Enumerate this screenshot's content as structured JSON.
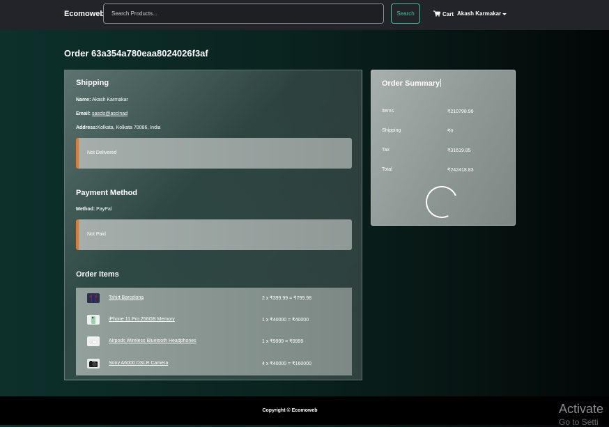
{
  "navbar": {
    "brand": "Ecomoweb",
    "search_placeholder": "Search Products...",
    "search_button": "Search",
    "cart_label": "Cart",
    "user_name": "Akash Karmakar"
  },
  "order": {
    "title": "Order 63a354a780eaa8024026f3af"
  },
  "shipping": {
    "title": "Shipping",
    "name_label": "Name:",
    "name_value": "Akash Karmakar",
    "email_label": "Email:",
    "email_value": "sascls@ascInad",
    "address_label": "Address:",
    "address_value": "Kolkata, Kolkata 70086, India",
    "status": "Not Delivered"
  },
  "payment": {
    "title": "Payment Method",
    "method_label": "Method:",
    "method_value": "PayPal",
    "status": "Not Paid"
  },
  "order_items": {
    "title": "Order Items",
    "items": [
      {
        "name": "Tshirt Barcelona",
        "calc": "2 x ₹399.99 = ₹799.98",
        "icon": "tshirt-icon"
      },
      {
        "name": "iPhone 11 Pro 256GB Memory",
        "calc": "1 x ₹40000 = ₹40000",
        "icon": "phone-icon"
      },
      {
        "name": "Airpods Wireless Bluetooth Headphones",
        "calc": "1 x ₹9999 = ₹9999",
        "icon": "airpods-icon"
      },
      {
        "name": "Sony A6000 DSLR Camera",
        "calc": "4 x ₹40000 = ₹160000",
        "icon": "camera-icon"
      }
    ]
  },
  "summary": {
    "title": "Order Summary",
    "rows": [
      {
        "label": "Items",
        "value": "₹210798.98"
      },
      {
        "label": "Shipping",
        "value": "₹0"
      },
      {
        "label": "Tax",
        "value": "₹31619.85"
      },
      {
        "label": "Total",
        "value": "₹242418.83"
      }
    ]
  },
  "footer": {
    "copyright": "Copyright © Ecomoweb"
  },
  "watermark": {
    "line1": "Activate",
    "line2": "Go to Setti"
  },
  "colors": {
    "accent_search": "#3fc59b",
    "alert_border": "#e8792a",
    "navbar_bg": "#222429"
  }
}
